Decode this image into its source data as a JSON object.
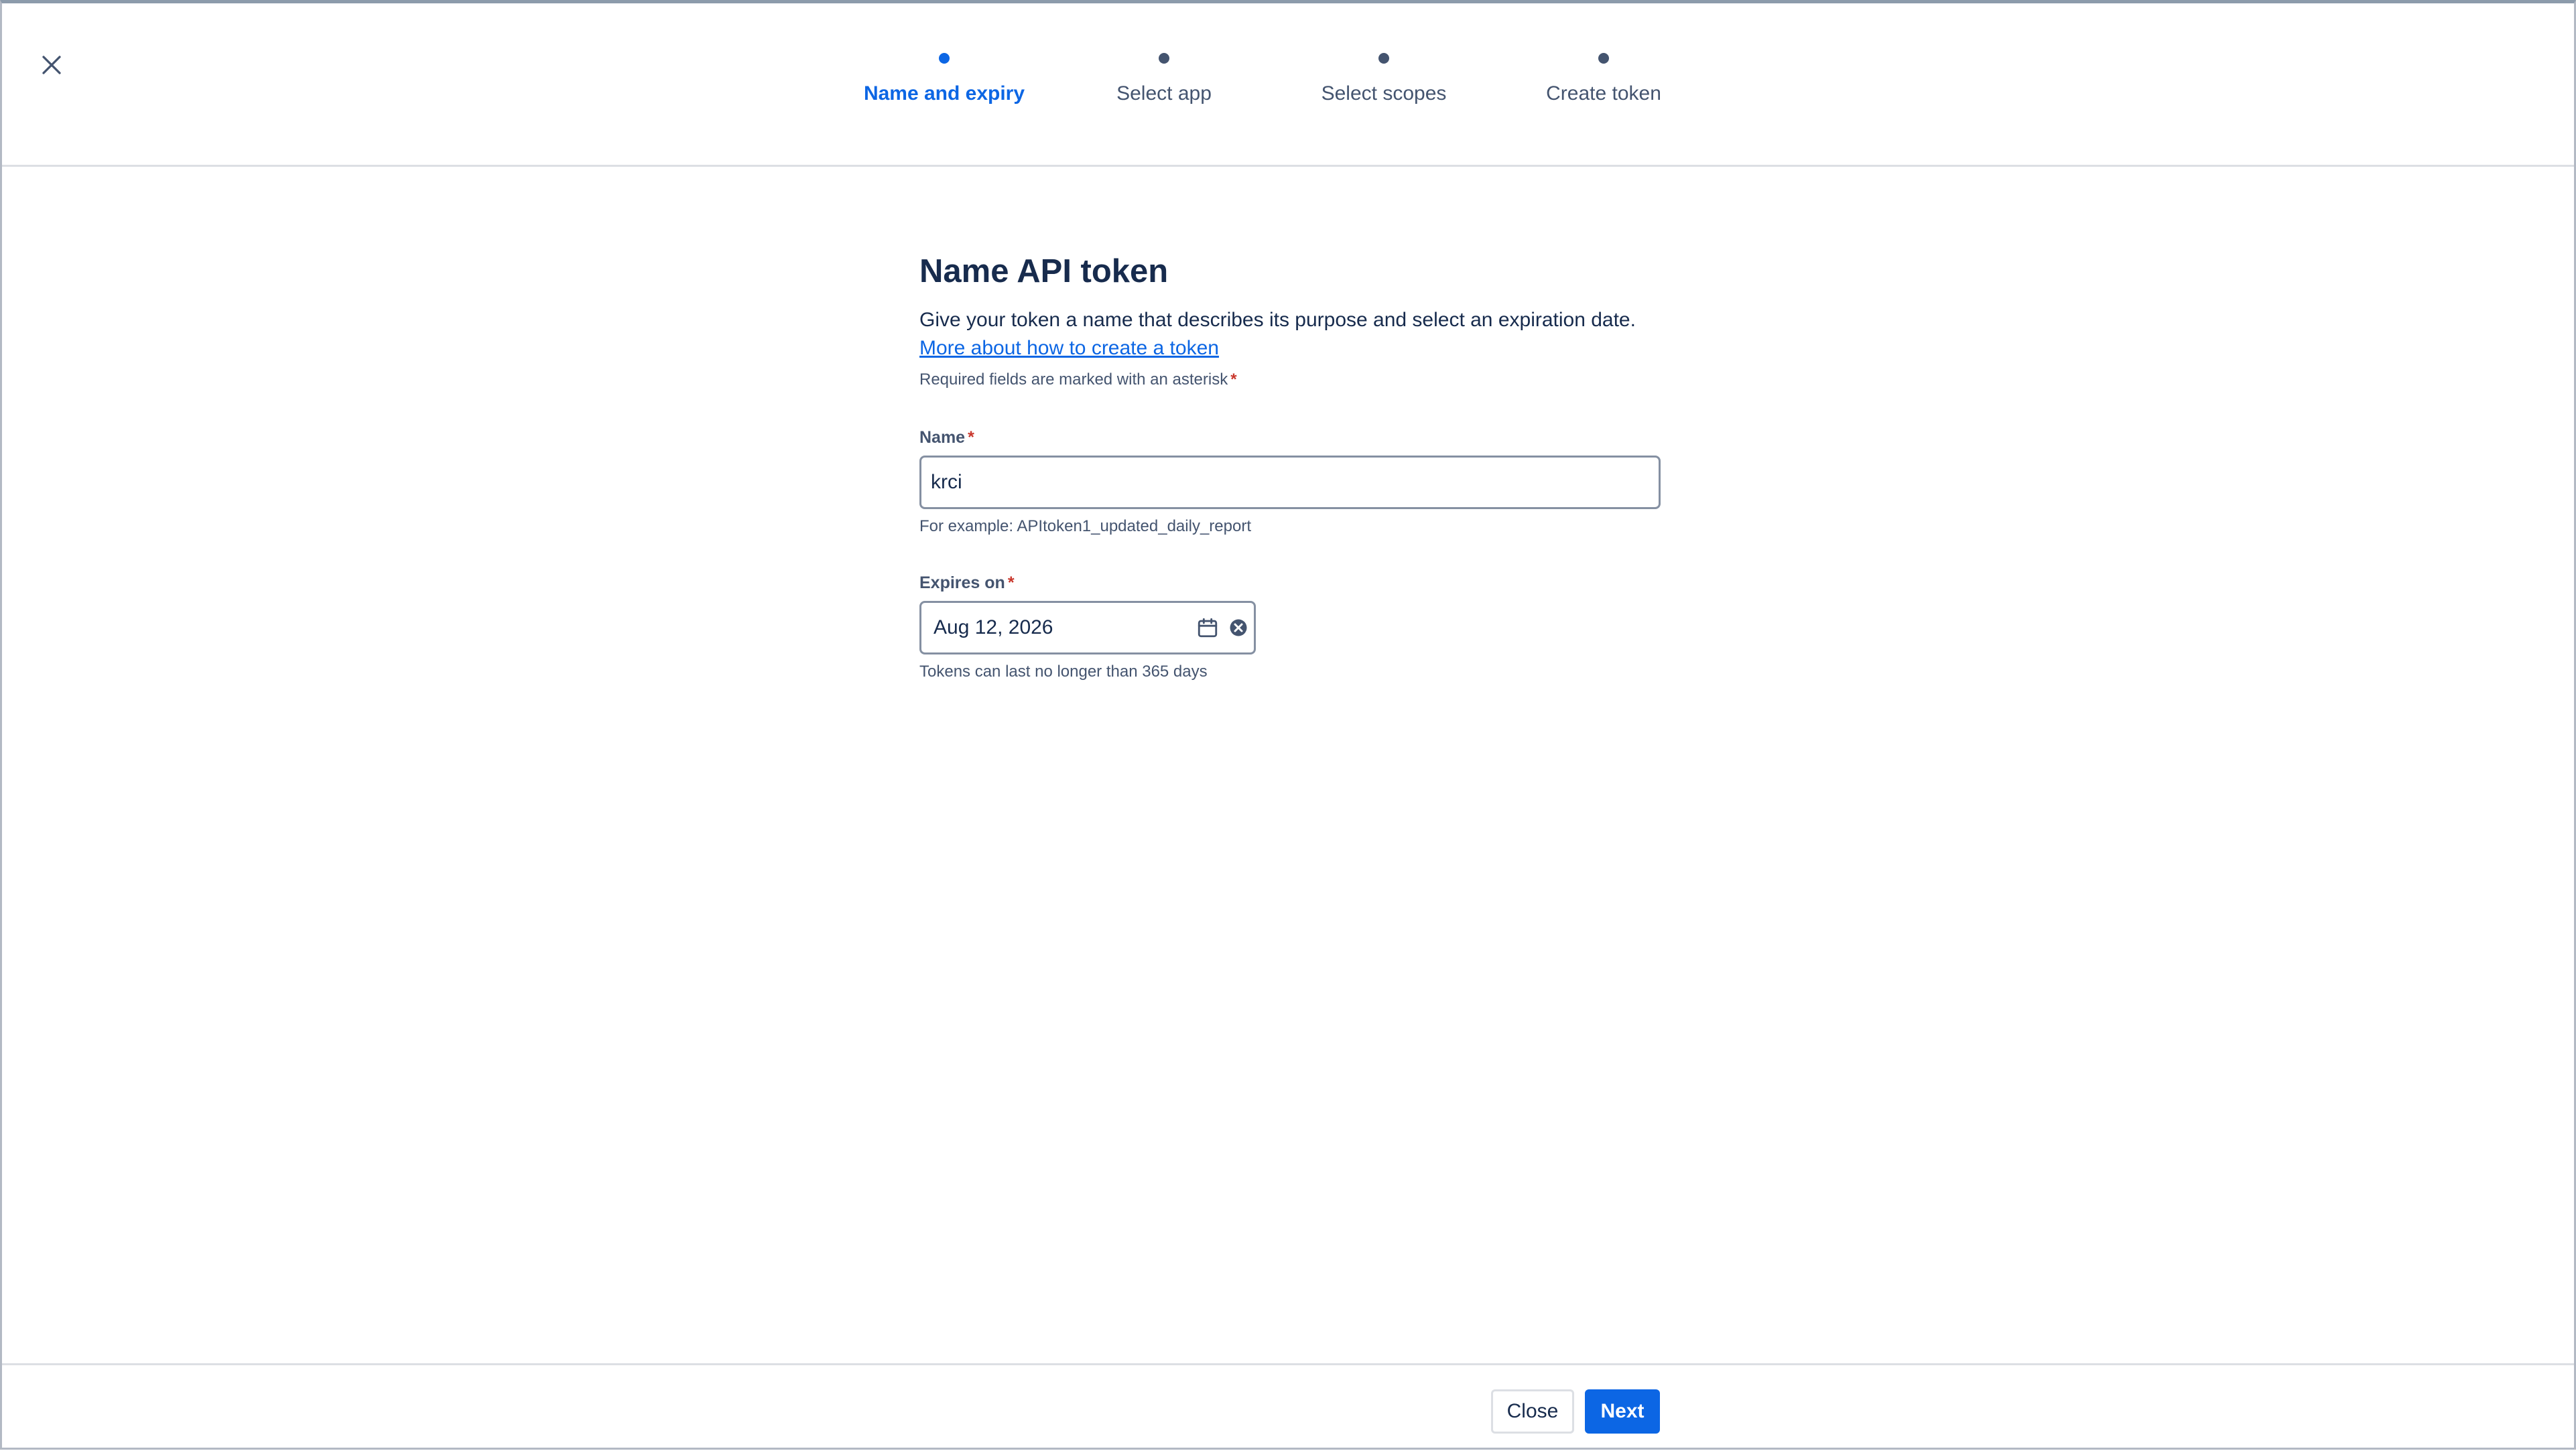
{
  "stepper": {
    "steps": [
      {
        "label": "Name and expiry",
        "active": true
      },
      {
        "label": "Select app",
        "active": false
      },
      {
        "label": "Select scopes",
        "active": false
      },
      {
        "label": "Create token",
        "active": false
      }
    ]
  },
  "form": {
    "title": "Name API token",
    "description": "Give your token a name that describes its purpose and select an expiration date.",
    "link_text": "More about how to create a token",
    "required_note": "Required fields are marked with an asterisk",
    "asterisk": "*",
    "name": {
      "label": "Name",
      "value": "krci",
      "helper": "For example: APItoken1_updated_daily_report"
    },
    "expires": {
      "label": "Expires on",
      "value": "Aug 12, 2026",
      "helper": "Tokens can last no longer than 365 days"
    }
  },
  "footer": {
    "close_label": "Close",
    "next_label": "Next"
  },
  "colors": {
    "primary": "#0c66e4",
    "text": "#172b4d",
    "subtle": "#44546f",
    "danger": "#c9372c"
  },
  "icons": {
    "close": "close-icon",
    "calendar": "calendar-icon",
    "clear": "clear-icon"
  }
}
